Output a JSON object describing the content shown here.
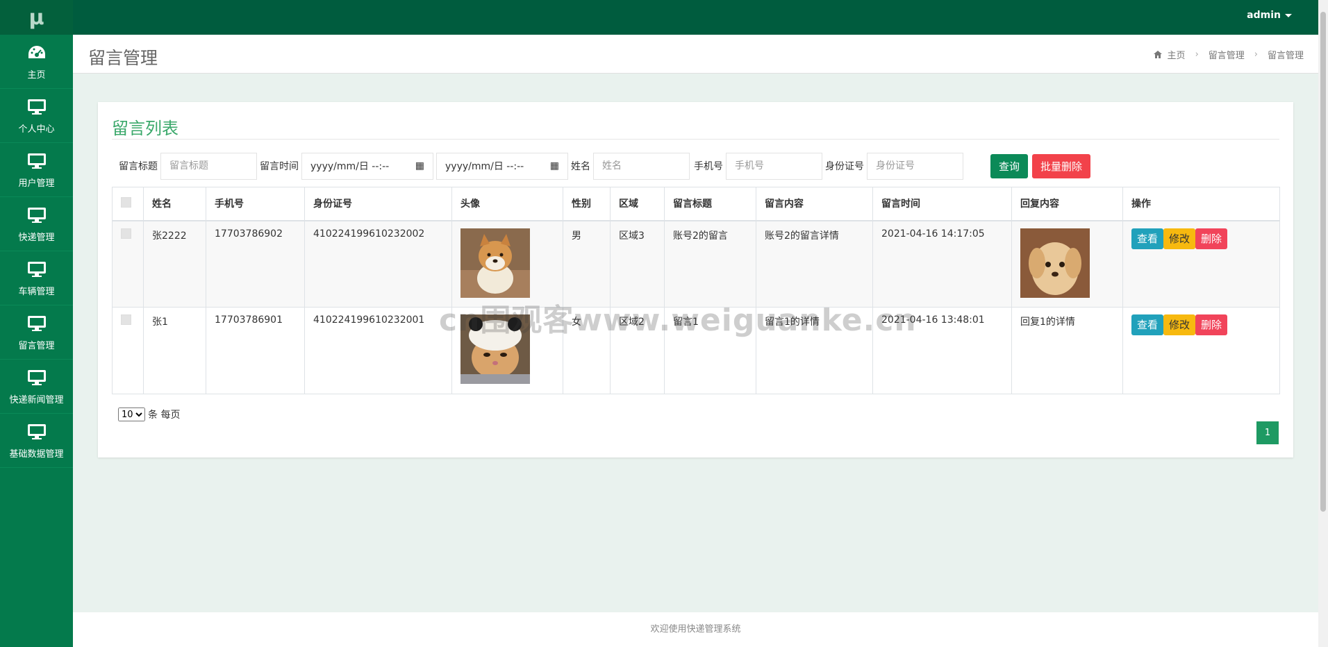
{
  "sidebar": {
    "logo": "μ",
    "items": [
      {
        "label": "主页",
        "icon": "dashboard-icon"
      },
      {
        "label": "个人中心",
        "icon": "monitor-icon"
      },
      {
        "label": "用户管理",
        "icon": "monitor-icon"
      },
      {
        "label": "快递管理",
        "icon": "monitor-icon"
      },
      {
        "label": "车辆管理",
        "icon": "monitor-icon"
      },
      {
        "label": "留言管理",
        "icon": "monitor-icon"
      },
      {
        "label": "快递新闻管理",
        "icon": "monitor-icon"
      },
      {
        "label": "基础数据管理",
        "icon": "monitor-icon"
      }
    ]
  },
  "topbar": {
    "user": "admin"
  },
  "header": {
    "title": "留言管理",
    "breadcrumb": [
      "主页",
      "留言管理",
      "留言管理"
    ]
  },
  "card": {
    "title": "留言列表",
    "filters": {
      "title_label": "留言标题",
      "title_placeholder": "留言标题",
      "time_label": "留言时间",
      "date_start": "yyyy/mm/日 --:--",
      "date_end": "yyyy/mm/日 --:--",
      "name_label": "姓名",
      "name_placeholder": "姓名",
      "phone_label": "手机号",
      "phone_placeholder": "手机号",
      "id_label": "身份证号",
      "id_placeholder": "身份证号",
      "query_btn": "查询",
      "batch_delete_btn": "批量删除"
    },
    "table": {
      "headers": [
        "姓名",
        "手机号",
        "身份证号",
        "头像",
        "性别",
        "区域",
        "留言标题",
        "留言内容",
        "留言时间",
        "回复内容",
        "操作"
      ],
      "rows": [
        {
          "name": "张2222",
          "phone": "17703786902",
          "idcard": "410224199610232002",
          "gender": "男",
          "area": "区域3",
          "msg_title": "账号2的留言",
          "msg_content": "账号2的留言详情",
          "msg_time": "2021-04-16 14:17:05",
          "reply": ""
        },
        {
          "name": "张1",
          "phone": "17703786901",
          "idcard": "410224199610232001",
          "gender": "女",
          "area": "区域2",
          "msg_title": "留言1",
          "msg_content": "留言1的详情",
          "msg_time": "2021-04-16 13:48:01",
          "reply": "回复1的详情"
        }
      ],
      "actions": {
        "view": "查看",
        "edit": "修改",
        "delete": "删除"
      }
    },
    "pager": {
      "page_size": "10",
      "suffix": "条 每页",
      "current_page": "1"
    }
  },
  "footer": {
    "text": "欢迎使用快递管理系统"
  },
  "watermark": "cn围观客www.weiguanke.cn",
  "colors": {
    "sidebar": "#047a4c",
    "topbar": "#005c3e",
    "accent": "#3aa86a"
  }
}
